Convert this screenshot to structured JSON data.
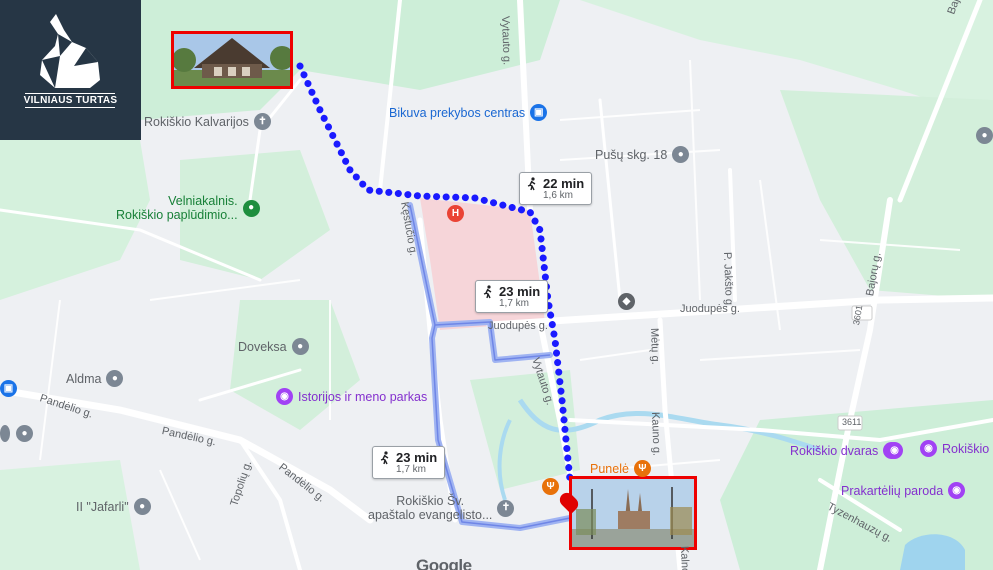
{
  "brand": {
    "name": "VILNIAUS TURTAS"
  },
  "routes": [
    {
      "time": "22 min",
      "distance": "1,6 km",
      "selected": true
    },
    {
      "time": "23 min",
      "distance": "1,7 km",
      "selected": false
    },
    {
      "time": "23 min",
      "distance": "1,7 km",
      "selected": false
    }
  ],
  "places": {
    "bikuva": "Bikuva prekybos centras",
    "pusu": "Pušų skg. 18",
    "kalvarijos": "Rokiškio Kalvarijos",
    "velniaknalis_1": "Velniakalnis.",
    "velniaknalis_2": "Rokiškio paplūdimio...",
    "doveksa": "Doveksa",
    "aldma": "Aldma",
    "istorijos": "Istorijos ir meno parkas",
    "jafarli": "II \"Jafarli\"",
    "evangelisto_1": "Rokiškio Šv.",
    "evangelisto_2": "apaštalo evangelisto...",
    "punele": "Punelė",
    "dvaras": "Rokiškio dvaras",
    "rokiskio_cut": "Rokiškio",
    "prakarteliu": "Prakartėlių paroda"
  },
  "streets": {
    "vytauto_n": "Vytauto g.",
    "vytauto_s": "Vytauto g.",
    "juodupes_e": "Juodupės g.",
    "juodupes_w": "Juodupės g.",
    "kestucio": "Kęstučio g.",
    "metu": "Mėtų g.",
    "kauno": "Kauno g.",
    "pjaksto": "P. Jakšto g.",
    "bajoru_n": "Bajorų g.",
    "bajoru": "Bajorų g.",
    "pandelio_w": "Pandėlio g.",
    "pandelio_m": "Pandėlio g.",
    "pandelio_e": "Pandėlio g.",
    "topoliu": "Topolių g.",
    "tyzenhauzu": "Tyzenhauzų g.",
    "r3601": "3601",
    "r3611": "3611",
    "kalno": "Kalno g."
  },
  "footer": {
    "logo": "Google"
  },
  "colors": {
    "route_selected": "#1a1aff",
    "route_alt": "#9bb0f0",
    "hospital": "#f5d0d4",
    "park": "#c9ecd4",
    "water": "#a9daf0",
    "pin_red": "#e00000"
  }
}
